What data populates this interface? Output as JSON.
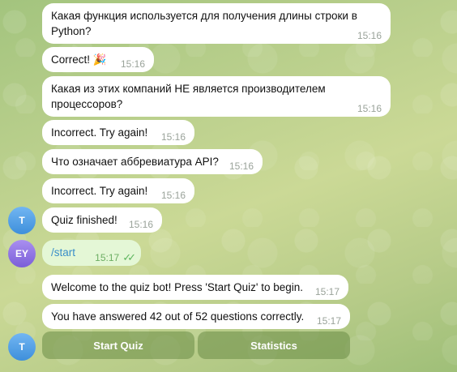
{
  "messages": [
    {
      "text": "Какая функция используется для получения длины строки в Python?",
      "time": "15:16"
    },
    {
      "text": "Correct! 🎉",
      "time": "15:16"
    },
    {
      "text": "Какая из этих компаний НЕ является производителем процессоров?",
      "time": "15:16"
    },
    {
      "text": "Incorrect. Try again!",
      "time": "15:16"
    },
    {
      "text": "Что означает аббревиатура API?",
      "time": "15:16"
    },
    {
      "text": "Incorrect. Try again!",
      "time": "15:16"
    },
    {
      "text": "Quiz finished!",
      "time": "15:16"
    },
    {
      "text": "/start",
      "time": "15:17"
    },
    {
      "text": "Welcome to the quiz bot! Press 'Start Quiz' to begin.",
      "time": "15:17"
    },
    {
      "text": "You have answered 42 out of 52 questions correctly.",
      "time": "15:17"
    }
  ],
  "avatars": {
    "bot": {
      "initial": "T",
      "color": "#4f9fe5"
    },
    "user": {
      "initial": "EY",
      "color": "#8b6fe0"
    }
  },
  "keyboard": {
    "start_quiz": "Start Quiz",
    "statistics": "Statistics"
  },
  "status": {
    "read_icon": "double-check-icon"
  }
}
